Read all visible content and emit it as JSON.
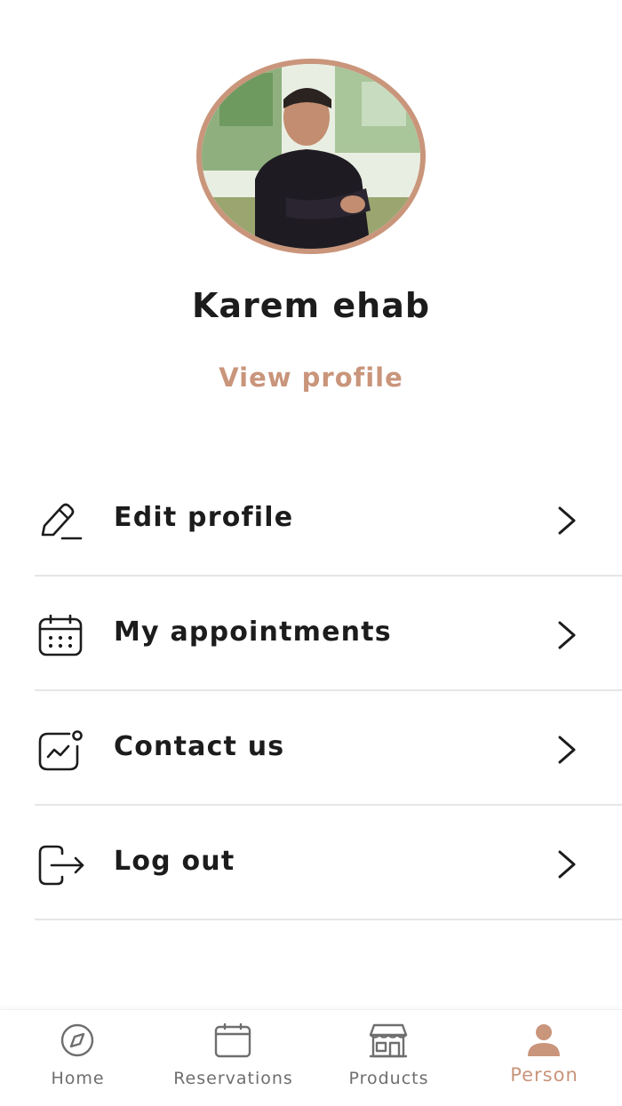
{
  "profile": {
    "name": "Karem ehab",
    "view_profile_label": "View profile"
  },
  "menu": {
    "items": [
      {
        "label": "Edit profile",
        "icon": "pencil-icon"
      },
      {
        "label": "My appointments",
        "icon": "calendar-icon"
      },
      {
        "label": "Contact us",
        "icon": "chart-notification-icon"
      },
      {
        "label": "Log out",
        "icon": "logout-icon"
      }
    ]
  },
  "bottom_nav": {
    "items": [
      {
        "label": "Home",
        "icon": "compass-icon"
      },
      {
        "label": "Reservations",
        "icon": "calendar-icon"
      },
      {
        "label": "Products",
        "icon": "store-icon"
      },
      {
        "label": "Person",
        "icon": "person-icon",
        "active": true
      }
    ]
  },
  "colors": {
    "accent": "#c9957b",
    "text": "#1c1c1c",
    "nav_inactive": "#6e6e6e",
    "divider": "#e6e6e6"
  }
}
